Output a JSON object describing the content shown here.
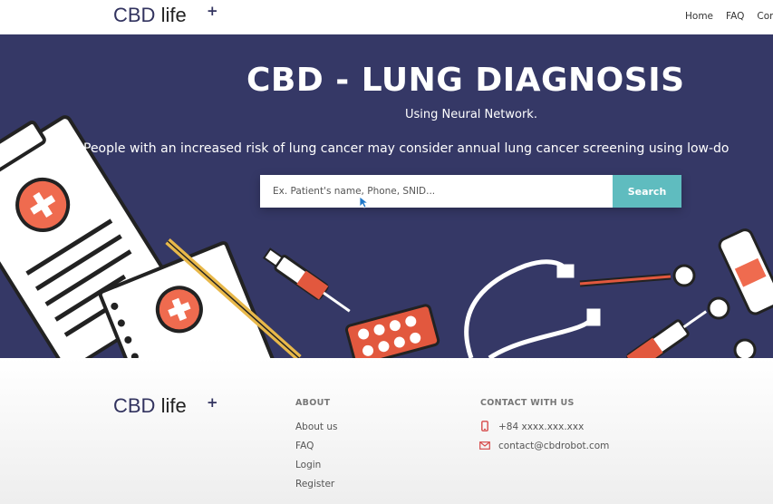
{
  "brand": {
    "name_part1": "CBD",
    "name_part2": "life",
    "mark": "+"
  },
  "nav": {
    "items": [
      "Home",
      "FAQ",
      "Con"
    ]
  },
  "hero": {
    "title": "CBD - LUNG DIAGNOSIS",
    "subtitle": "Using Neural Network.",
    "tagline": "People with an increased risk of lung cancer may consider annual lung cancer screening using low-do"
  },
  "search": {
    "placeholder": "Ex. Patient's name, Phone, SNID...",
    "value": "",
    "button_label": "Search"
  },
  "footer": {
    "about": {
      "title": "ABOUT",
      "links": [
        "About us",
        "FAQ",
        "Login",
        "Register"
      ]
    },
    "contact": {
      "title": "CONTACT WITH US",
      "phone": "+84 xxxx.xxx.xxx",
      "email": "contact@cbdrobot.com"
    }
  },
  "colors": {
    "hero_bg": "#353866",
    "accent": "#5fbcbf",
    "brand": "#32335f",
    "icon_red": "#d64a4a"
  },
  "icons": [
    "phone-icon",
    "mail-icon",
    "pointer-cursor-icon"
  ]
}
